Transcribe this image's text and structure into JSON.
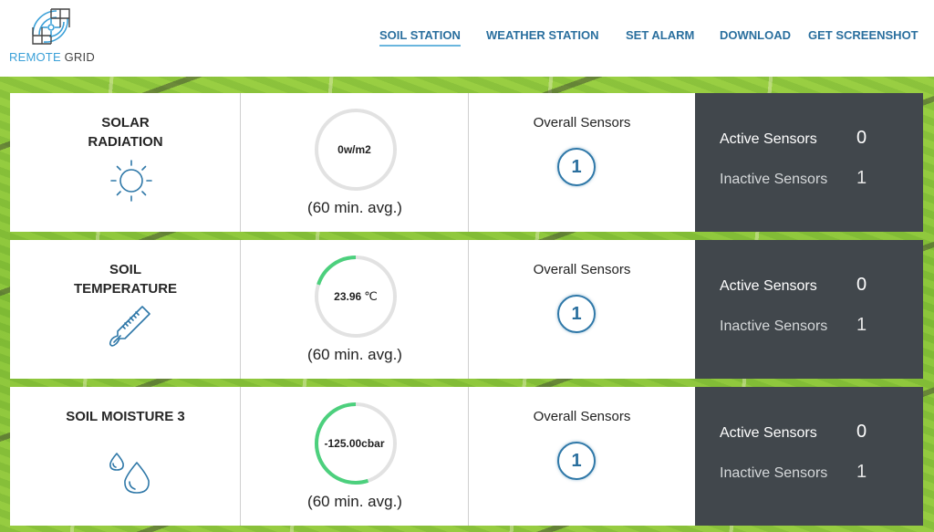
{
  "brand": {
    "name_part1": "REMOTE",
    "name_part2": "GRID",
    "accent_color": "#3aa0d8"
  },
  "nav": {
    "items": [
      {
        "label": "SOIL STATION",
        "active": true
      },
      {
        "label": "WEATHER STATION",
        "active": false
      },
      {
        "label": "SET ALARM",
        "active": false
      },
      {
        "label": "DOWNLOAD",
        "active": false
      },
      {
        "label": "GET SCREENSHOT",
        "active": false
      }
    ]
  },
  "colors": {
    "nav_text": "#2a6f9e",
    "gauge_fill": "#4cd07d",
    "gauge_track": "#e2e2e2",
    "stats_panel": "#41474c",
    "icon_blue": "#2f78a8"
  },
  "sensors": [
    {
      "title_line1": "SOLAR",
      "title_line2": "RADIATION",
      "icon": "sun-icon",
      "value": "0w/m2",
      "unit_symbol": "",
      "gauge_fraction": 0.0,
      "avg_label": "(60 min. avg.)",
      "overall_label": "Overall Sensors",
      "overall_count": "1",
      "active_label": "Active Sensors",
      "active_count": "0",
      "inactive_label": "Inactive Sensors",
      "inactive_count": "1"
    },
    {
      "title_line1": "SOIL",
      "title_line2": "TEMPERATURE",
      "icon": "thermometer-icon",
      "value": "23.96",
      "unit_symbol": "℃",
      "gauge_fraction": 0.2,
      "avg_label": "(60 min. avg.)",
      "overall_label": "Overall Sensors",
      "overall_count": "1",
      "active_label": "Active Sensors",
      "active_count": "0",
      "inactive_label": "Inactive Sensors",
      "inactive_count": "1"
    },
    {
      "title_line1": "SOIL MOISTURE 3",
      "title_line2": "",
      "icon": "water-drops-icon",
      "value": "-125.00cbar",
      "unit_symbol": "",
      "gauge_fraction": 0.55,
      "avg_label": "(60 min. avg.)",
      "overall_label": "Overall Sensors",
      "overall_count": "1",
      "active_label": "Active Sensors",
      "active_count": "0",
      "inactive_label": "Inactive Sensors",
      "inactive_count": "1"
    }
  ]
}
